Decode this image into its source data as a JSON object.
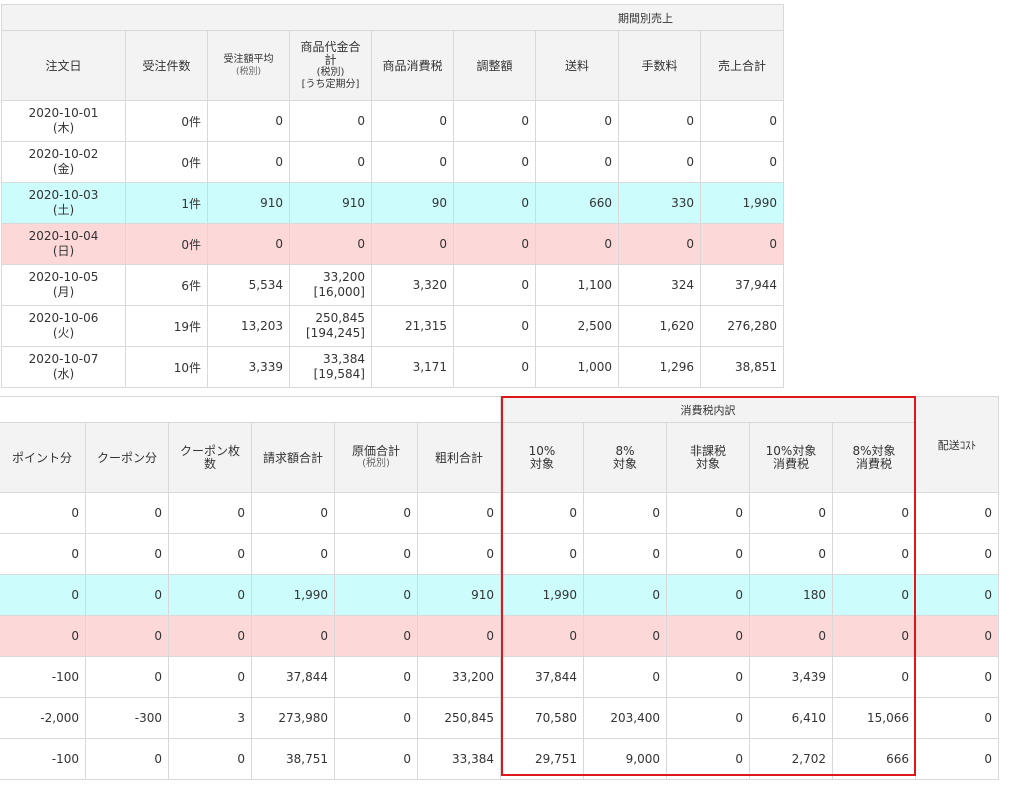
{
  "top": {
    "group_label": "期間別売上",
    "headers": {
      "date": "注文日",
      "orders": "受注件数",
      "avg_line1": "受注額平均",
      "avg_line2": "(税別)",
      "prod_line1": "商品代金合",
      "prod_line2": "計",
      "prod_line3": "(税別)",
      "prod_line4": "[うち定期分]",
      "tax": "商品消費税",
      "adjust": "調整額",
      "shipping": "送料",
      "fee": "手数料",
      "sales": "売上合計"
    },
    "rows": [
      {
        "date": "2020-10-01",
        "dow": "(木)",
        "orders": "0件",
        "avg": "0",
        "prod": "0",
        "prod_sub": "",
        "tax": "0",
        "adjust": "0",
        "shipping": "0",
        "fee": "0",
        "sales": "0"
      },
      {
        "date": "2020-10-02",
        "dow": "(金)",
        "orders": "0件",
        "avg": "0",
        "prod": "0",
        "prod_sub": "",
        "tax": "0",
        "adjust": "0",
        "shipping": "0",
        "fee": "0",
        "sales": "0"
      },
      {
        "date": "2020-10-03",
        "dow": "(土)",
        "orders": "1件",
        "avg": "910",
        "prod": "910",
        "prod_sub": "",
        "tax": "90",
        "adjust": "0",
        "shipping": "660",
        "fee": "330",
        "sales": "1,990"
      },
      {
        "date": "2020-10-04",
        "dow": "(日)",
        "orders": "0件",
        "avg": "0",
        "prod": "0",
        "prod_sub": "",
        "tax": "0",
        "adjust": "0",
        "shipping": "0",
        "fee": "0",
        "sales": "0"
      },
      {
        "date": "2020-10-05",
        "dow": "(月)",
        "orders": "6件",
        "avg": "5,534",
        "prod": "33,200",
        "prod_sub": "[16,000]",
        "tax": "3,320",
        "adjust": "0",
        "shipping": "1,100",
        "fee": "324",
        "sales": "37,944"
      },
      {
        "date": "2020-10-06",
        "dow": "(火)",
        "orders": "19件",
        "avg": "13,203",
        "prod": "250,845",
        "prod_sub": "[194,245]",
        "tax": "21,315",
        "adjust": "0",
        "shipping": "2,500",
        "fee": "1,620",
        "sales": "276,280"
      },
      {
        "date": "2020-10-07",
        "dow": "(水)",
        "orders": "10件",
        "avg": "3,339",
        "prod": "33,384",
        "prod_sub": "[19,584]",
        "tax": "3,171",
        "adjust": "0",
        "shipping": "1,000",
        "fee": "1,296",
        "sales": "38,851"
      }
    ]
  },
  "bottom": {
    "tax_group_label": "消費税内訳",
    "headers": {
      "points": "ポイント分",
      "coupon": "クーポン分",
      "coupon_cnt_line1": "クーポン枚",
      "coupon_cnt_line2": "数",
      "billing": "請求額合計",
      "cost_line1": "原価合計",
      "cost_line2": "(税別)",
      "gross": "粗利合計",
      "t10_line1": "10%",
      "t10_line2": "対象",
      "t8_line1": "8%",
      "t8_line2": "対象",
      "nontax_line1": "非課税",
      "nontax_line2": "対象",
      "tax10_line1": "10%対象",
      "tax10_line2": "消費税",
      "tax8_line1": "8%対象",
      "tax8_line2": "消費税",
      "delivery_cost": "配送ｺｽﾄ"
    },
    "rows": [
      {
        "points": "0",
        "coupon": "0",
        "coupon_cnt": "0",
        "billing": "0",
        "cost": "0",
        "gross": "0",
        "t10": "0",
        "t8": "0",
        "nontax": "0",
        "tax10": "0",
        "tax8": "0",
        "delivery": "0"
      },
      {
        "points": "0",
        "coupon": "0",
        "coupon_cnt": "0",
        "billing": "0",
        "cost": "0",
        "gross": "0",
        "t10": "0",
        "t8": "0",
        "nontax": "0",
        "tax10": "0",
        "tax8": "0",
        "delivery": "0"
      },
      {
        "points": "0",
        "coupon": "0",
        "coupon_cnt": "0",
        "billing": "1,990",
        "cost": "0",
        "gross": "910",
        "t10": "1,990",
        "t8": "0",
        "nontax": "0",
        "tax10": "180",
        "tax8": "0",
        "delivery": "0"
      },
      {
        "points": "0",
        "coupon": "0",
        "coupon_cnt": "0",
        "billing": "0",
        "cost": "0",
        "gross": "0",
        "t10": "0",
        "t8": "0",
        "nontax": "0",
        "tax10": "0",
        "tax8": "0",
        "delivery": "0"
      },
      {
        "points": "-100",
        "coupon": "0",
        "coupon_cnt": "0",
        "billing": "37,844",
        "cost": "0",
        "gross": "33,200",
        "t10": "37,844",
        "t8": "0",
        "nontax": "0",
        "tax10": "3,439",
        "tax8": "0",
        "delivery": "0"
      },
      {
        "points": "-2,000",
        "coupon": "-300",
        "coupon_cnt": "3",
        "billing": "273,980",
        "cost": "0",
        "gross": "250,845",
        "t10": "70,580",
        "t8": "203,400",
        "nontax": "0",
        "tax10": "6,410",
        "tax8": "15,066",
        "delivery": "0"
      },
      {
        "points": "-100",
        "coupon": "0",
        "coupon_cnt": "0",
        "billing": "38,751",
        "cost": "0",
        "gross": "33,384",
        "t10": "29,751",
        "t8": "9,000",
        "nontax": "0",
        "tax10": "2,702",
        "tax8": "666",
        "delivery": "0"
      }
    ]
  },
  "colors": {
    "saturday_row": "#ccfcfc",
    "sunday_row": "#fdd8d8",
    "highlight_box": "#e0171a",
    "header_bg": "#f3f3f3"
  }
}
